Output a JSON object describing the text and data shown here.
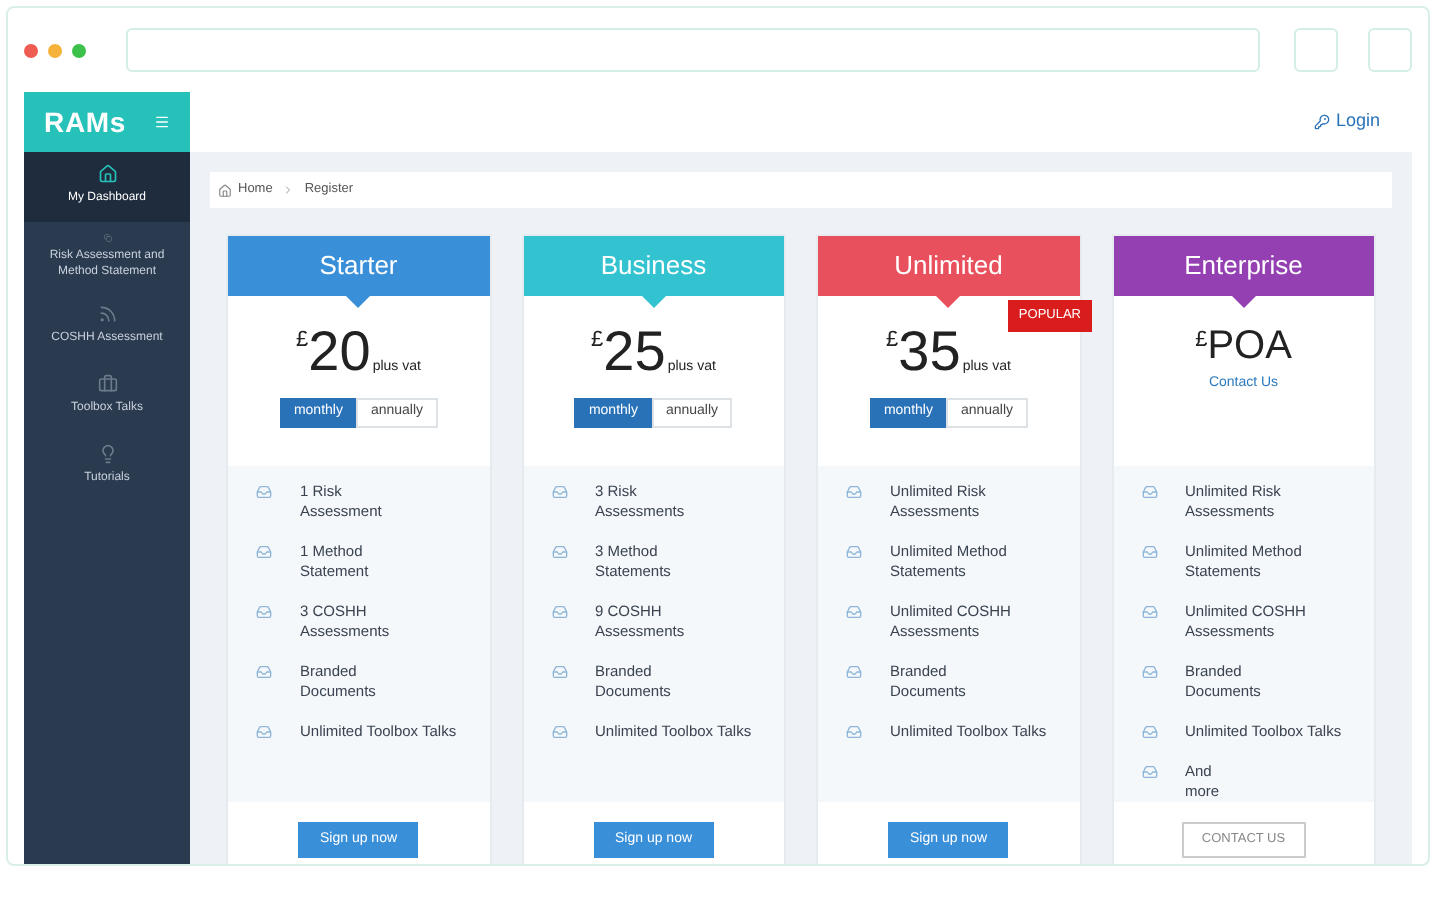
{
  "logo": "RAMs",
  "header": {
    "login": "Login"
  },
  "sidebar": {
    "items": [
      {
        "label": "My Dashboard",
        "selected": true
      },
      {
        "label": "Risk Assessment and Method Statement",
        "selected": false
      },
      {
        "label": "COSHH Assessment",
        "selected": false
      },
      {
        "label": "Toolbox Talks",
        "selected": false
      },
      {
        "label": "Tutorials",
        "selected": false
      }
    ]
  },
  "breadcrumb": [
    "Home",
    "Register"
  ],
  "plans": [
    {
      "name": "Starter",
      "color": "#3a8fd9",
      "currency": "£",
      "amount": "20",
      "suffix": "plus vat",
      "billing": [
        {
          "label": "monthly",
          "selected": true
        },
        {
          "label": "annually",
          "selected": false
        }
      ],
      "features": [
        "1 Risk\nAssessment",
        "1 Method\nStatement",
        "3 COSHH\nAssessments",
        "Branded\nDocuments",
        "Unlimited Toolbox Talks"
      ],
      "button": {
        "label": "Sign up now",
        "kind": "primary"
      }
    },
    {
      "name": "Business",
      "color": "#33c3d0",
      "currency": "£",
      "amount": "25",
      "suffix": "plus vat",
      "billing": [
        {
          "label": "monthly",
          "selected": true
        },
        {
          "label": "annually",
          "selected": false
        }
      ],
      "features": [
        "3 Risk\nAssessments",
        "3 Method\nStatements",
        "9 COSHH\nAssessments",
        "Branded\nDocuments",
        "Unlimited Toolbox Talks"
      ],
      "button": {
        "label": "Sign up now",
        "kind": "primary"
      }
    },
    {
      "name": "Unlimited",
      "color": "#e9505d",
      "badge": "POPULAR",
      "currency": "£",
      "amount": "35",
      "suffix": "plus vat",
      "billing": [
        {
          "label": "monthly",
          "selected": true
        },
        {
          "label": "annually",
          "selected": false
        }
      ],
      "features": [
        "Unlimited Risk\nAssessments",
        "Unlimited Method\nStatements",
        "Unlimited COSHH\nAssessments",
        "Branded\nDocuments",
        "Unlimited Toolbox Talks"
      ],
      "button": {
        "label": "Sign up now",
        "kind": "primary"
      }
    },
    {
      "name": "Enterprise",
      "color": "#9440b3",
      "currency": "£",
      "amount": "POA",
      "link": "Contact Us",
      "features": [
        "Unlimited Risk\nAssessments",
        "Unlimited Method\nStatements",
        "Unlimited COSHH\nAssessments",
        "Branded\nDocuments",
        "Unlimited Toolbox Talks",
        "And\nmore"
      ],
      "button": {
        "label": "CONTACT US",
        "kind": "outline"
      }
    }
  ]
}
